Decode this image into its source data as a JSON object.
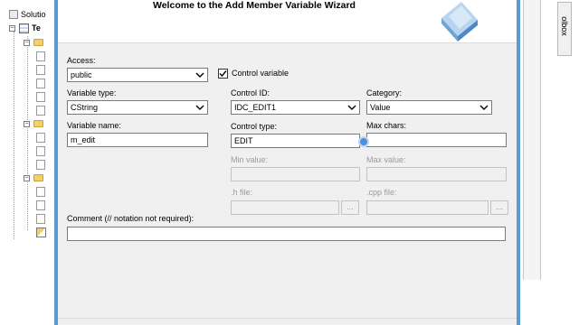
{
  "solution_explorer": {
    "items": [
      {
        "label": "Solutio"
      },
      {
        "label": "Te"
      }
    ]
  },
  "toolbox": {
    "label": "olbox"
  },
  "dialog": {
    "title": "Welcome to the Add Member Variable Wizard",
    "access": {
      "label": "Access:",
      "value": "public"
    },
    "control_variable": {
      "label": "Control variable",
      "checked": true
    },
    "variable_type": {
      "label": "Variable type:",
      "value": "CString"
    },
    "control_id": {
      "label": "Control ID:",
      "value": "IDC_EDIT1"
    },
    "category": {
      "label": "Category:",
      "value": "Value"
    },
    "variable_name": {
      "label": "Variable name:",
      "value": "m_edit"
    },
    "control_type": {
      "label": "Control type:",
      "value": "EDIT"
    },
    "max_chars": {
      "label": "Max chars:",
      "value": ""
    },
    "min_value": {
      "label": "Min value:",
      "value": ""
    },
    "max_value": {
      "label": "Max value:",
      "value": ""
    },
    "h_file": {
      "label": ".h file:",
      "value": "",
      "browse": "..."
    },
    "cpp_file": {
      "label": ".cpp file:",
      "value": "",
      "browse": "..."
    },
    "comment": {
      "label": "Comment (// notation not required):",
      "value": ""
    }
  },
  "colors": {
    "accent": "#5b9bd5",
    "dialog_bg": "#f0f0f0",
    "cursor": "#4a8fe0"
  }
}
